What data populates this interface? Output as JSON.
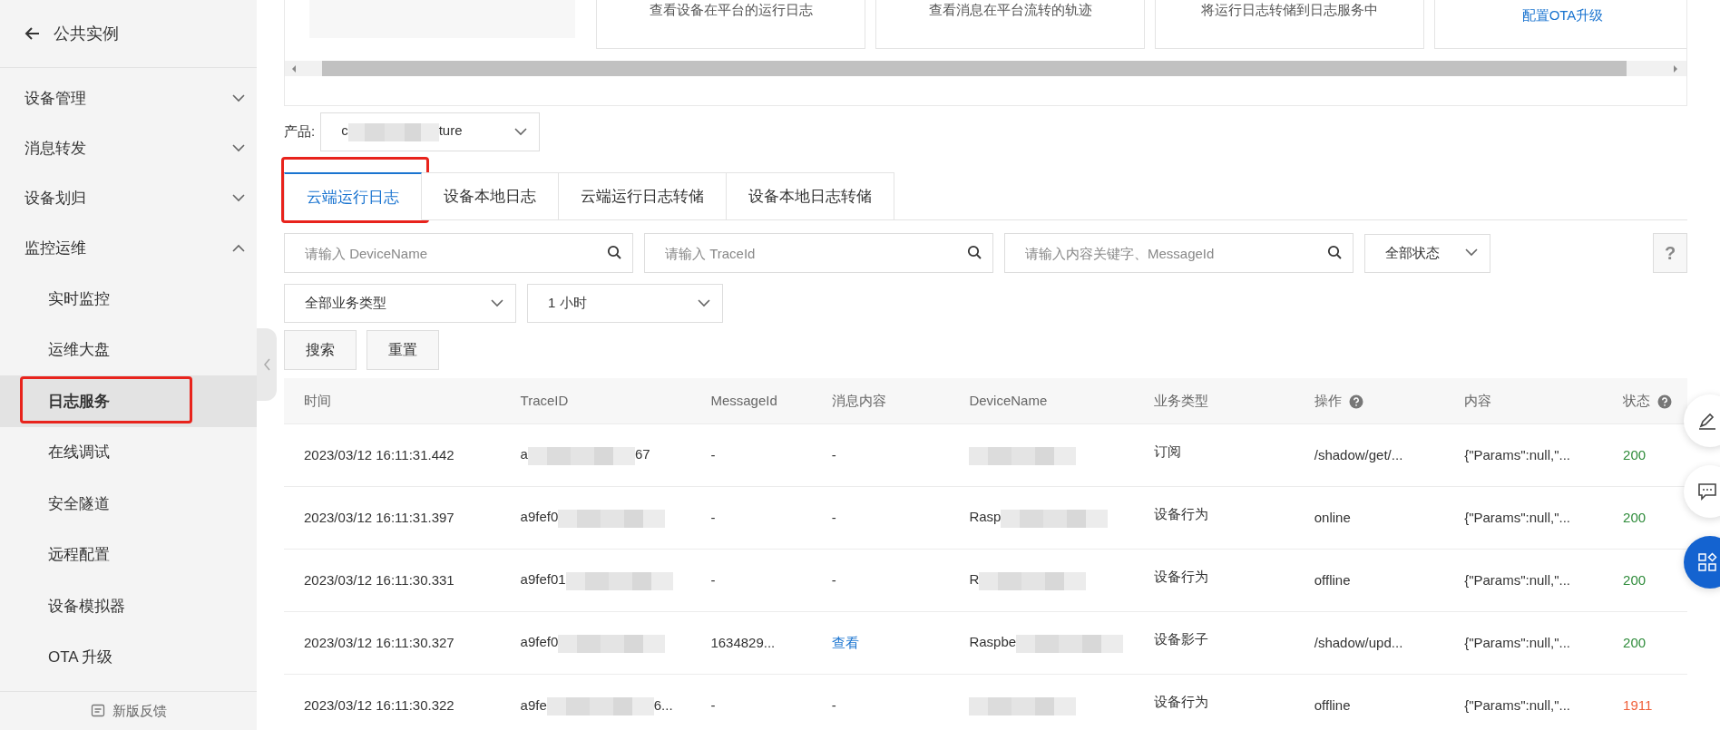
{
  "sidebar": {
    "back": {
      "label": "公共实例"
    },
    "items": [
      {
        "label": "设备管理",
        "expanded": false
      },
      {
        "label": "消息转发",
        "expanded": false
      },
      {
        "label": "设备划归",
        "expanded": false
      },
      {
        "label": "监控运维",
        "expanded": true,
        "children": [
          {
            "label": "实时监控",
            "selected": false,
            "annotated": false
          },
          {
            "label": "运维大盘",
            "selected": false,
            "annotated": false
          },
          {
            "label": "日志服务",
            "selected": true,
            "annotated": true
          },
          {
            "label": "在线调试",
            "selected": false,
            "annotated": false
          },
          {
            "label": "安全隧道",
            "selected": false,
            "annotated": false
          },
          {
            "label": "远程配置",
            "selected": false,
            "annotated": false
          },
          {
            "label": "设备模拟器",
            "selected": false,
            "annotated": false
          },
          {
            "label": "OTA 升级",
            "selected": false,
            "annotated": false
          }
        ]
      }
    ],
    "feedback": {
      "label": "新版反馈"
    }
  },
  "top_cards": [
    {
      "kind": "blank"
    },
    {
      "kind": "text",
      "text": "查看设备在平台的运行日志"
    },
    {
      "kind": "text",
      "text": "查看消息在平台流转的轨迹"
    },
    {
      "kind": "text",
      "text": "将运行日志转储到日志服务中"
    },
    {
      "kind": "link",
      "text": "配置OTA升级"
    }
  ],
  "product": {
    "label": "产品:",
    "value": {
      "text": "c",
      "masked": true,
      "tail": "ture"
    }
  },
  "tabs": [
    {
      "label": "云端运行日志",
      "selected": true,
      "annotated": true
    },
    {
      "label": "设备本地日志",
      "selected": false,
      "annotated": false
    },
    {
      "label": "云端运行日志转储",
      "selected": false,
      "annotated": false
    },
    {
      "label": "设备本地日志转储",
      "selected": false,
      "annotated": false
    }
  ],
  "filters": {
    "device_search": {
      "placeholder": "请输入 DeviceName"
    },
    "trace_search": {
      "placeholder": "请输入 TraceId"
    },
    "keyword_search": {
      "placeholder": "请输入内容关键字、MessageId"
    },
    "status_select": {
      "value": "全部状态"
    },
    "help": {
      "label": "?"
    },
    "type_select": {
      "value": "全部业务类型"
    },
    "time_select": {
      "value": "1 小时"
    },
    "buttons": [
      "搜索",
      "重置"
    ]
  },
  "table": {
    "columns": [
      {
        "label": "时间",
        "help": false
      },
      {
        "label": "TraceID",
        "help": false
      },
      {
        "label": "MessageId",
        "help": false
      },
      {
        "label": "消息内容",
        "help": false
      },
      {
        "label": "DeviceName",
        "help": false
      },
      {
        "label": "业务类型",
        "help": false
      },
      {
        "label": "操作",
        "help": true
      },
      {
        "label": "内容",
        "help": false
      },
      {
        "label": "状态",
        "help": true
      }
    ],
    "rows": [
      {
        "time": "2023/03/12 16:11:31.442",
        "trace_id": {
          "text": "a",
          "masked": true,
          "tail": "67"
        },
        "message_id": "-",
        "message_content": {
          "text": "-",
          "link": false
        },
        "device_name": {
          "masked": true
        },
        "business_type": "订阅",
        "operation": "/shadow/get/...",
        "content": "{\"Params\":null,\"...",
        "status": {
          "text": "200",
          "color": "#2e8b3a"
        }
      },
      {
        "time": "2023/03/12 16:11:31.397",
        "trace_id": {
          "text": "a9fef0",
          "masked": true
        },
        "message_id": "-",
        "message_content": {
          "text": "-",
          "link": false
        },
        "device_name": {
          "text": "Rasp",
          "masked": true
        },
        "business_type": "设备行为",
        "operation": "online",
        "content": "{\"Params\":null,\"...",
        "status": {
          "text": "200",
          "color": "#2e8b3a"
        }
      },
      {
        "time": "2023/03/12 16:11:30.331",
        "trace_id": {
          "text": "a9fef01",
          "masked": true
        },
        "message_id": "-",
        "message_content": {
          "text": "-",
          "link": false
        },
        "device_name": {
          "text": "R",
          "masked": true
        },
        "business_type": "设备行为",
        "operation": "offline",
        "content": "{\"Params\":null,\"...",
        "status": {
          "text": "200",
          "color": "#2e8b3a"
        }
      },
      {
        "time": "2023/03/12 16:11:30.327",
        "trace_id": {
          "text": "a9fef0",
          "masked": true
        },
        "message_id": "1634829...",
        "message_content": {
          "text": "查看",
          "link": true
        },
        "device_name": {
          "text": "Raspbe",
          "masked": true
        },
        "business_type": "设备影子",
        "operation": "/shadow/upd...",
        "content": "{\"Params\":null,\"...",
        "status": {
          "text": "200",
          "color": "#2e8b3a"
        }
      },
      {
        "time": "2023/03/12 16:11:30.322",
        "trace_id": {
          "text": "a9fe",
          "masked": true,
          "tail": "6..."
        },
        "message_id": "-",
        "message_content": {
          "text": "-",
          "link": false
        },
        "device_name": {
          "masked": true
        },
        "business_type": "设备行为",
        "operation": "offline",
        "content": "{\"Params\":null,\"...",
        "status": {
          "text": "1911",
          "color": "#f0603a"
        }
      }
    ]
  }
}
